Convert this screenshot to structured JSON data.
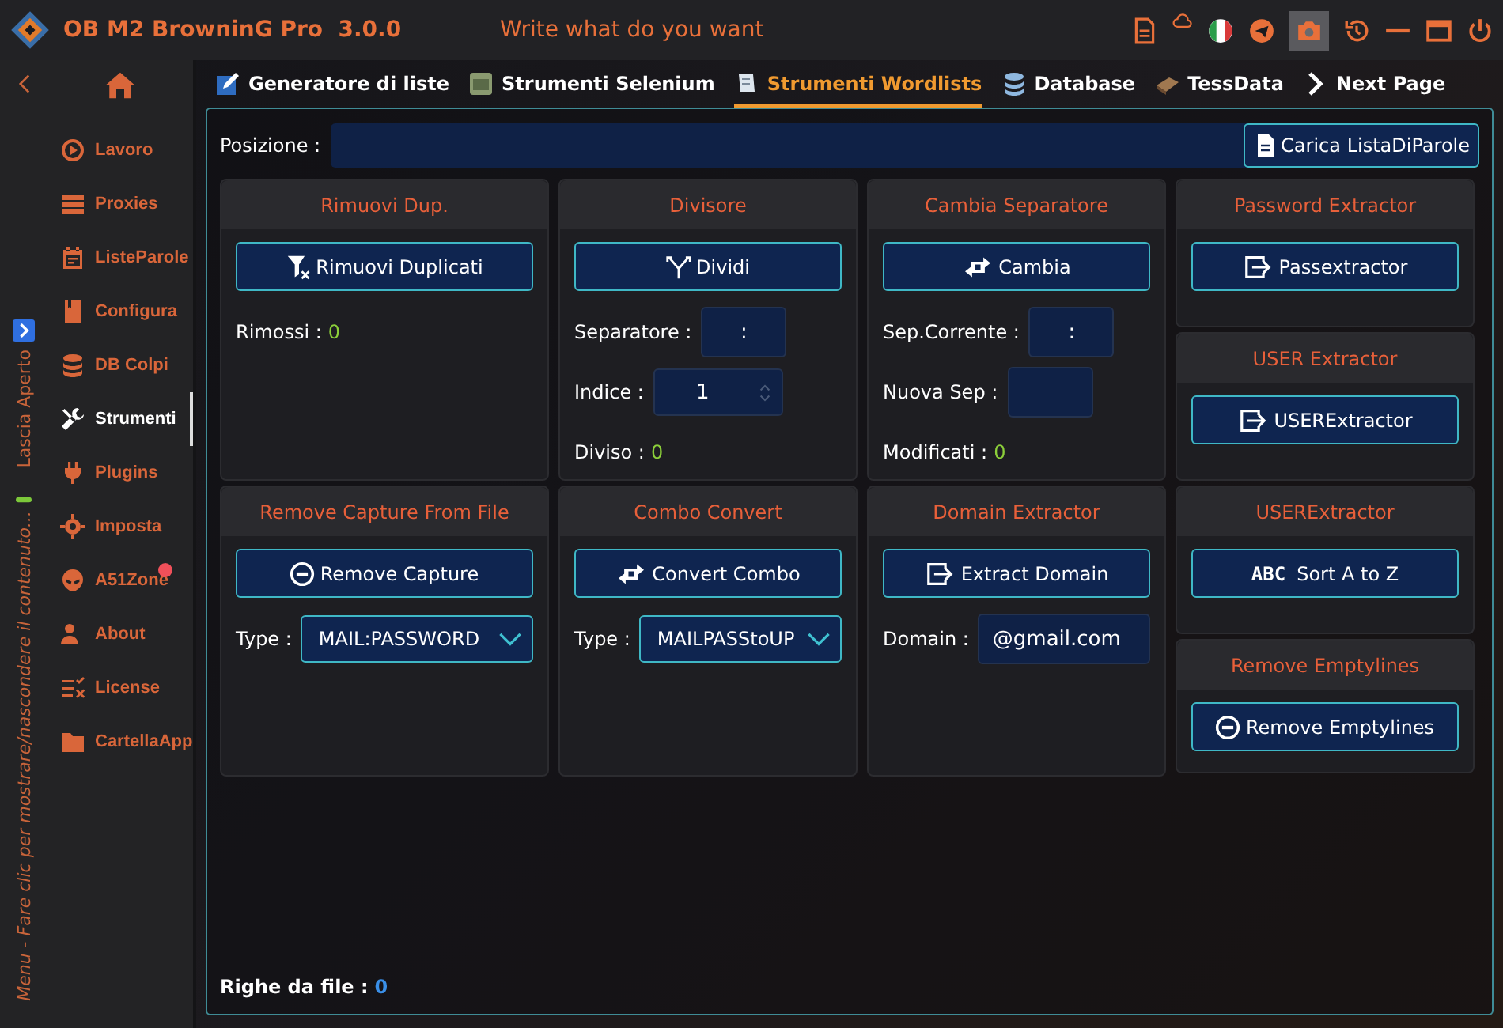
{
  "window": {
    "title": "OB M2 BrowninG Pro  3.0.0",
    "slogan": "Write what do you want"
  },
  "side_strip": {
    "pin_label": "Lascia Aperto",
    "hint": "Menu - Fare clic per mostrare/nascondere il contenuto..."
  },
  "sidebar": {
    "items": [
      {
        "label": "Lavoro",
        "selected": false,
        "badge": false
      },
      {
        "label": "Proxies",
        "selected": false,
        "badge": false
      },
      {
        "label": "ListeParole",
        "selected": false,
        "badge": false
      },
      {
        "label": "Configura",
        "selected": false,
        "badge": false
      },
      {
        "label": "DB Colpi",
        "selected": false,
        "badge": false
      },
      {
        "label": "Strumenti",
        "selected": true,
        "badge": false
      },
      {
        "label": "Plugins",
        "selected": false,
        "badge": false
      },
      {
        "label": "Imposta",
        "selected": false,
        "badge": false
      },
      {
        "label": "A51Zone",
        "selected": false,
        "badge": true
      },
      {
        "label": "About",
        "selected": false,
        "badge": false
      },
      {
        "label": "License",
        "selected": false,
        "badge": false
      },
      {
        "label": "CartellaApp",
        "selected": false,
        "badge": false
      }
    ]
  },
  "tabs": [
    {
      "label": "Generatore di liste",
      "selected": false
    },
    {
      "label": "Strumenti Selenium",
      "selected": false
    },
    {
      "label": "Strumenti Wordlists",
      "selected": true
    },
    {
      "label": "Database",
      "selected": false
    },
    {
      "label": "TessData",
      "selected": false
    },
    {
      "label": "Next Page",
      "selected": false
    }
  ],
  "position": {
    "label": "Posizione :",
    "button": "Carica ListaDiParole"
  },
  "columns": [
    {
      "cards": [
        {
          "title": "Rimuovi Dup.",
          "button": {
            "label": "Rimuovi Duplicati"
          },
          "fields": [
            {
              "kind": "stat",
              "label": "Rimossi :",
              "value": "0"
            }
          ]
        },
        {
          "title": "Remove Capture From File",
          "button": {
            "label": "Remove Capture"
          },
          "fields": [
            {
              "kind": "select",
              "label": "Type :",
              "value": "MAIL:PASSWORD"
            }
          ]
        }
      ]
    },
    {
      "cards": [
        {
          "title": "Divisore",
          "button": {
            "label": "Dividi"
          },
          "fields": [
            {
              "kind": "input",
              "label": "Separatore :",
              "value": ":"
            },
            {
              "kind": "spinner",
              "label": "Indice :",
              "value": "1"
            },
            {
              "kind": "stat",
              "label": "Diviso :",
              "value": "0"
            }
          ]
        },
        {
          "title": "Combo Convert",
          "button": {
            "label": "Convert Combo"
          },
          "fields": [
            {
              "kind": "select",
              "label": "Type :",
              "value": "MAILPASStoUP"
            }
          ]
        }
      ]
    },
    {
      "cards": [
        {
          "title": "Cambia Separatore",
          "button": {
            "label": "Cambia"
          },
          "fields": [
            {
              "kind": "input",
              "label": "Sep.Corrente :",
              "value": ":"
            },
            {
              "kind": "input",
              "label": "Nuova Sep :"
            },
            {
              "kind": "stat",
              "label": "Modificati :",
              "value": "0"
            }
          ]
        },
        {
          "title": "Domain Extractor",
          "button": {
            "label": "Extract Domain"
          },
          "fields": [
            {
              "kind": "wide",
              "label": "Domain :",
              "value": "@gmail.com"
            }
          ]
        }
      ]
    },
    {
      "cards": [
        {
          "title": "Password Extractor",
          "button": {
            "label": "Passextractor"
          }
        },
        {
          "title": "USER Extractor",
          "button": {
            "label": "USERExtractor"
          }
        },
        {
          "title": "USERExtractor",
          "button": {
            "label": "Sort A to Z",
            "prefix": "ABC"
          }
        },
        {
          "title": "Remove Emptylines",
          "button": {
            "label": "Remove Emptylines"
          }
        }
      ]
    }
  ],
  "footer": {
    "label": "Righe da file :",
    "value": "0"
  }
}
